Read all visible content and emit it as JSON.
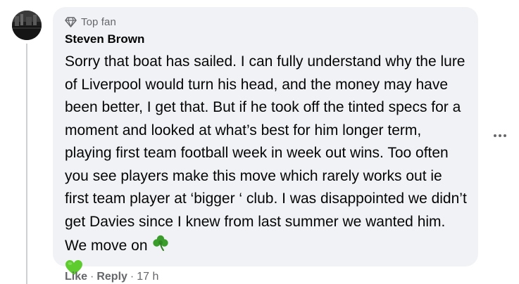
{
  "comment": {
    "badge": {
      "icon": "diamond-icon",
      "label": "Top fan"
    },
    "author": "Steven Brown",
    "text": "Sorry that boat has sailed. I can fully understand why the lure of Liverpool would turn his head, and the money may have been better, I get that. But if he took off the tinted specs for a moment and looked at what’s best for him longer term, playing first team football week in week out wins. Too often you see players make this move which rarely works out ie first team player at ‘bigger ‘ club. I was disappointed we didn’t get Davies since I knew from last summer we wanted him. We move on",
    "emojis": [
      "shamrock-emoji",
      "green-heart-emoji"
    ],
    "actions": {
      "like_label": "Like",
      "reply_label": "Reply",
      "separator": "·",
      "timestamp": "17 h"
    }
  },
  "colors": {
    "bubble_bg": "#f0f2f5",
    "text": "#050505",
    "secondary_text": "#65676b",
    "thread_line": "#ced0d4"
  }
}
